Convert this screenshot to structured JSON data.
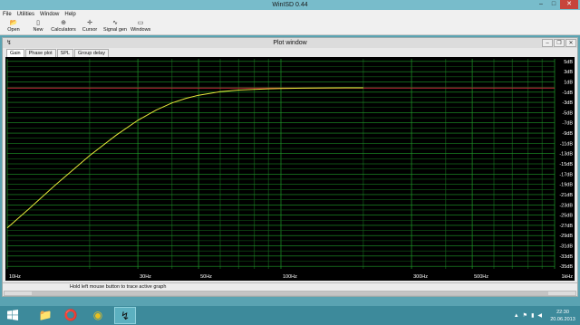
{
  "window": {
    "title": "WinISD 0.44"
  },
  "menu": [
    "File",
    "Utilities",
    "Window",
    "Help"
  ],
  "toolbar": [
    {
      "label": "Open",
      "icon": "open-folder-icon",
      "glyph": "📂"
    },
    {
      "label": "New",
      "icon": "new-document-icon",
      "glyph": "▯"
    },
    {
      "label": "Calculators",
      "icon": "calculator-icon",
      "glyph": "⊕"
    },
    {
      "label": "Cursor",
      "icon": "crosshair-icon",
      "glyph": "✛"
    },
    {
      "label": "Signal gen",
      "icon": "signal-generator-icon",
      "glyph": "∿"
    },
    {
      "label": "Windows",
      "icon": "window-icon",
      "glyph": "▭"
    }
  ],
  "plot_window": {
    "title": "Plot window",
    "tabs": [
      "Gain",
      "Phase plot",
      "SPL",
      "Group delay"
    ],
    "active_tab": "Gain",
    "status_text": "Hold left mouse button to trace active graph"
  },
  "chart_data": {
    "type": "line",
    "x_scale": "log",
    "xlim": [
      10,
      1000
    ],
    "ylim": [
      -35.5,
      5.5
    ],
    "x_tick_labels": [
      {
        "label": "10Hz",
        "value": 10
      },
      {
        "label": "30Hz",
        "value": 30
      },
      {
        "label": "50Hz",
        "value": 50
      },
      {
        "label": "100Hz",
        "value": 100
      },
      {
        "label": "300Hz",
        "value": 300
      },
      {
        "label": "500Hz",
        "value": 500
      },
      {
        "label": "1kHz",
        "value": 1000
      }
    ],
    "y_tick_labels": [
      "5dB",
      "3dB",
      "1dB",
      "-1dB",
      "-3dB",
      "-5dB",
      "-7dB",
      "-9dB",
      "-11dB",
      "-13dB",
      "-15dB",
      "-17dB",
      "-19dB",
      "-21dB",
      "-23dB",
      "-25dB",
      "-27dB",
      "-29dB",
      "-31dB",
      "-33dB",
      "-35dB"
    ],
    "y_tick_values": [
      5,
      3,
      1,
      -1,
      -3,
      -5,
      -7,
      -9,
      -11,
      -13,
      -15,
      -17,
      -19,
      -21,
      -23,
      -25,
      -27,
      -29,
      -31,
      -33,
      -35
    ],
    "grid": true,
    "series": [
      {
        "color": "#e8e83a",
        "x": [
          10,
          12,
          15,
          20,
          25,
          30,
          35,
          40,
          45,
          50,
          60,
          70,
          80,
          90,
          100,
          120,
          150,
          200
        ],
        "y": [
          -27.5,
          -23.8,
          -19.1,
          -13.4,
          -9.4,
          -6.5,
          -4.5,
          -3.1,
          -2.2,
          -1.6,
          -0.9,
          -0.6,
          -0.45,
          -0.35,
          -0.3,
          -0.22,
          -0.17,
          -0.15
        ]
      }
    ],
    "reference_line": {
      "y": -0.2,
      "color": "#c8283a"
    }
  },
  "taskbar": {
    "apps": [
      {
        "name": "file-explorer-icon",
        "glyph": "📁"
      },
      {
        "name": "opera-browser-icon",
        "glyph": "⭕"
      },
      {
        "name": "chrome-browser-icon",
        "glyph": "◉"
      },
      {
        "name": "winisd-taskbar-icon",
        "glyph": "↯"
      }
    ],
    "time": "22:30",
    "date": "20.06.2013"
  },
  "colors": {
    "plot_bg": "#000000",
    "grid_major": "#1f9b2a",
    "grid_minor": "#145f1a",
    "desktop": "#5aa3b2",
    "close_button": "#c7443c"
  }
}
